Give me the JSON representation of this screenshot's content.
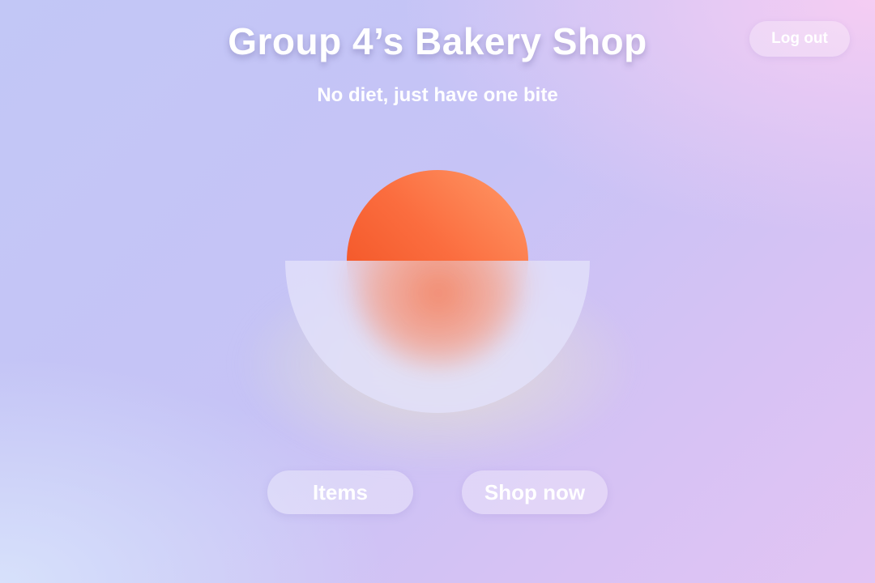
{
  "header": {
    "title": "Group 4’s Bakery Shop",
    "tagline": "No diet, just have one bite",
    "logout_label": "Log out"
  },
  "hero": {
    "ball_icon": "orange-sun-ball",
    "bowl_icon": "glass-bowl"
  },
  "actions": {
    "items_label": "Items",
    "shop_label": "Shop now"
  },
  "colors": {
    "accent": "#f5521f",
    "text": "#ffffff",
    "background_start": "#c2c7f6",
    "background_end": "#f5cdf3"
  }
}
